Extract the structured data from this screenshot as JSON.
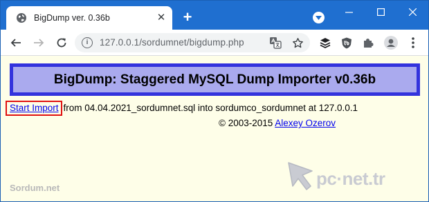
{
  "browser": {
    "tab_title": "BigDump ver. 0.36b",
    "tab_close": "✕",
    "new_tab": "+",
    "address": "127.0.0.1/sordumnet/bigdump.php"
  },
  "page": {
    "heading": "BigDump: Staggered MySQL Dump Importer v0.36b",
    "start_link": "Start Import",
    "start_text": " from 04.04.2021_sordumnet.sql into sordumco_sordumnet at 127.0.0.1",
    "copyright": "© 2003-2015 ",
    "author_link": "Alexey Ozerov"
  },
  "watermarks": {
    "left": "Sordum.net",
    "right": "pc·net.tr"
  },
  "colors": {
    "titlebar": "#1f6fd0",
    "page_bg": "#fefee8",
    "header_bg": "#aaaaee",
    "header_border": "#3333dd",
    "highlight_box": "#e01010",
    "link": "#0000ee"
  }
}
